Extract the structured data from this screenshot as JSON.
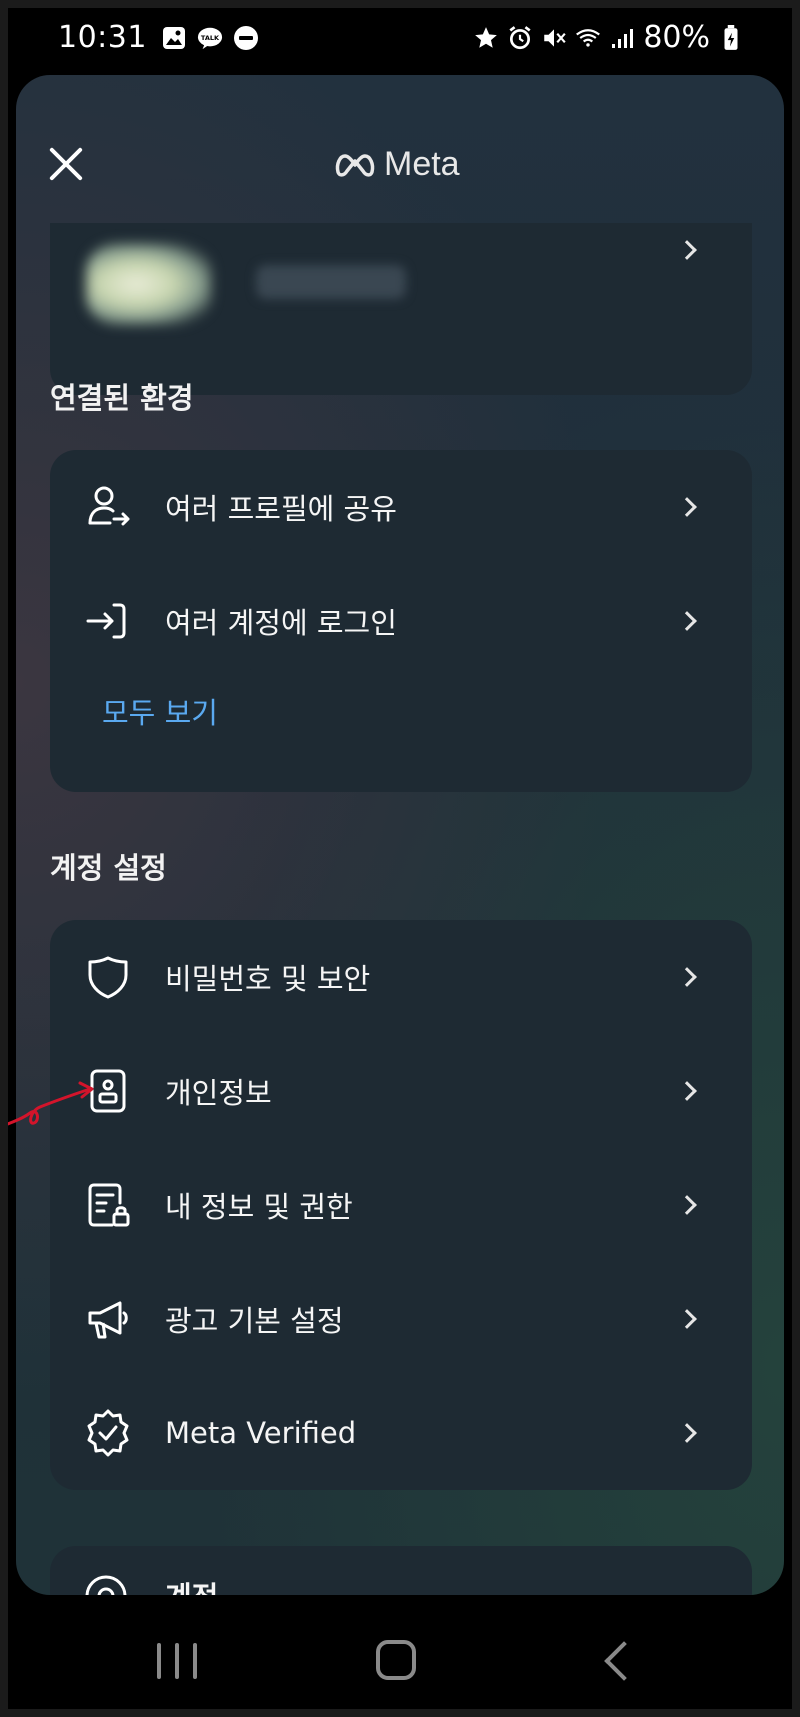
{
  "status_bar": {
    "time": "10:31",
    "battery": "80%",
    "icons_left": [
      "gallery-icon",
      "kakaotalk-icon",
      "dnd-icon"
    ],
    "icons_right": [
      "star-icon",
      "alarm-icon",
      "mute-icon",
      "wifi-icon",
      "signal-icon",
      "battery-icon"
    ],
    "talk_badge": "TALK"
  },
  "header": {
    "brand": "Meta",
    "close_icon": "close-icon"
  },
  "sections": {
    "connected": {
      "title": "연결된 환경",
      "items": [
        {
          "label": "여러 프로필에 공유",
          "icon": "profile-share-icon"
        },
        {
          "label": "여러 계정에 로그인",
          "icon": "login-icon"
        }
      ],
      "see_all": "모두 보기"
    },
    "account": {
      "title": "계정 설정",
      "items": [
        {
          "label": "비밀번호 및 보안",
          "icon": "shield-icon"
        },
        {
          "label": "개인정보",
          "icon": "id-card-icon"
        },
        {
          "label": "내 정보 및 권한",
          "icon": "info-permission-icon"
        },
        {
          "label": "광고 기본 설정",
          "icon": "megaphone-icon"
        },
        {
          "label": "Meta Verified",
          "icon": "verified-badge-icon"
        }
      ]
    },
    "next": {
      "label": "계정"
    }
  },
  "colors": {
    "accent_link": "#5aa9f0",
    "card_bg": "#1e2a33",
    "annotation": "#d3142b"
  }
}
